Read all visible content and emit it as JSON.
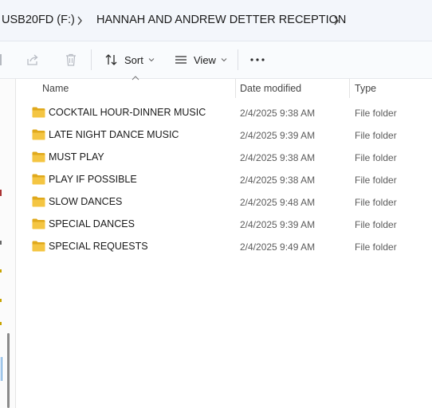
{
  "address": {
    "drive": "USB20FD (F:)",
    "folder": "HANNAH AND ANDREW DETTER RECEPTION"
  },
  "toolbar": {
    "sort_label": "Sort",
    "view_label": "View"
  },
  "columns": {
    "name": "Name",
    "date_modified": "Date modified",
    "type": "Type"
  },
  "files": [
    {
      "name": "COCKTAIL HOUR-DINNER MUSIC",
      "date": "2/4/2025 9:38 AM",
      "type": "File folder"
    },
    {
      "name": "LATE NIGHT DANCE MUSIC",
      "date": "2/4/2025 9:39 AM",
      "type": "File folder"
    },
    {
      "name": "MUST PLAY",
      "date": "2/4/2025 9:38 AM",
      "type": "File folder"
    },
    {
      "name": "PLAY IF POSSIBLE",
      "date": "2/4/2025 9:38 AM",
      "type": "File folder"
    },
    {
      "name": "SLOW DANCES",
      "date": "2/4/2025 9:48 AM",
      "type": "File folder"
    },
    {
      "name": "SPECIAL DANCES",
      "date": "2/4/2025 9:39 AM",
      "type": "File folder"
    },
    {
      "name": "SPECIAL REQUESTS",
      "date": "2/4/2025 9:49 AM",
      "type": "File folder"
    }
  ],
  "colors": {
    "folder": "#f4c542",
    "folder_dark": "#e0a91c",
    "accent": "#0067c0"
  },
  "icons": {
    "share": "share-icon",
    "delete": "trash-icon",
    "sort": "sort-icon",
    "view": "view-icon",
    "more": "more-icon",
    "folder": "folder-icon"
  }
}
